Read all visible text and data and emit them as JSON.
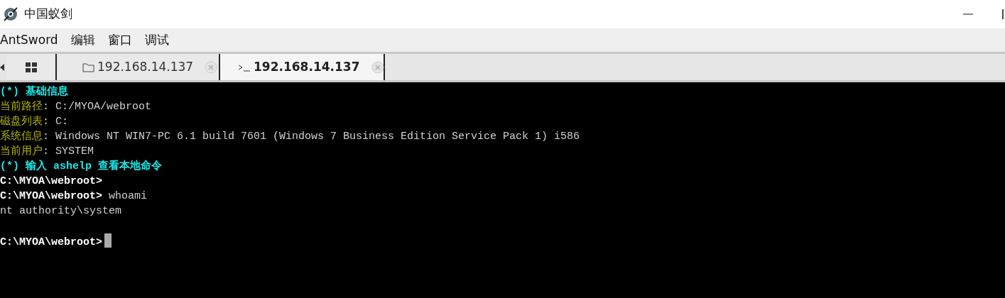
{
  "window": {
    "title": "中国蚁剑"
  },
  "menu": [
    "AntSword",
    "编辑",
    "窗口",
    "调试"
  ],
  "tabs": [
    {
      "kind": "home",
      "selected": false
    },
    {
      "kind": "files",
      "label": "192.168.14.137",
      "selected": false
    },
    {
      "kind": "terminal",
      "label": "192.168.14.137",
      "selected": true
    }
  ],
  "terminal": {
    "cursor": true,
    "lines": [
      [
        {
          "kind": "heading",
          "text": "(*) 基础信息"
        }
      ],
      [
        {
          "kind": "label",
          "text": "当前路径"
        },
        {
          "kind": "value",
          "text": ": C:/MYOA/webroot"
        }
      ],
      [
        {
          "kind": "label",
          "text": "磁盘列表"
        },
        {
          "kind": "value",
          "text": ": C:"
        }
      ],
      [
        {
          "kind": "label",
          "text": "系统信息"
        },
        {
          "kind": "value",
          "text": ": Windows NT WIN7-PC 6.1 build 7601 (Windows 7 Business Edition Service Pack 1) i586"
        }
      ],
      [
        {
          "kind": "label",
          "text": "当前用户"
        },
        {
          "kind": "value",
          "text": ": SYSTEM"
        }
      ],
      [
        {
          "kind": "heading",
          "text": "(*) 输入 ashelp 查看本地命令"
        }
      ],
      [
        {
          "kind": "prompt",
          "text": "C:\\MYOA\\webroot>"
        }
      ],
      [
        {
          "kind": "prompt",
          "text": "C:\\MYOA\\webroot>"
        },
        {
          "kind": "value",
          "text": " whoami"
        }
      ],
      [
        {
          "kind": "value",
          "text": "nt authority\\system"
        }
      ],
      [
        {
          "kind": "prompt",
          "text": "C:\\MYOA\\webroot>",
          "blank_before": true
        }
      ]
    ]
  }
}
